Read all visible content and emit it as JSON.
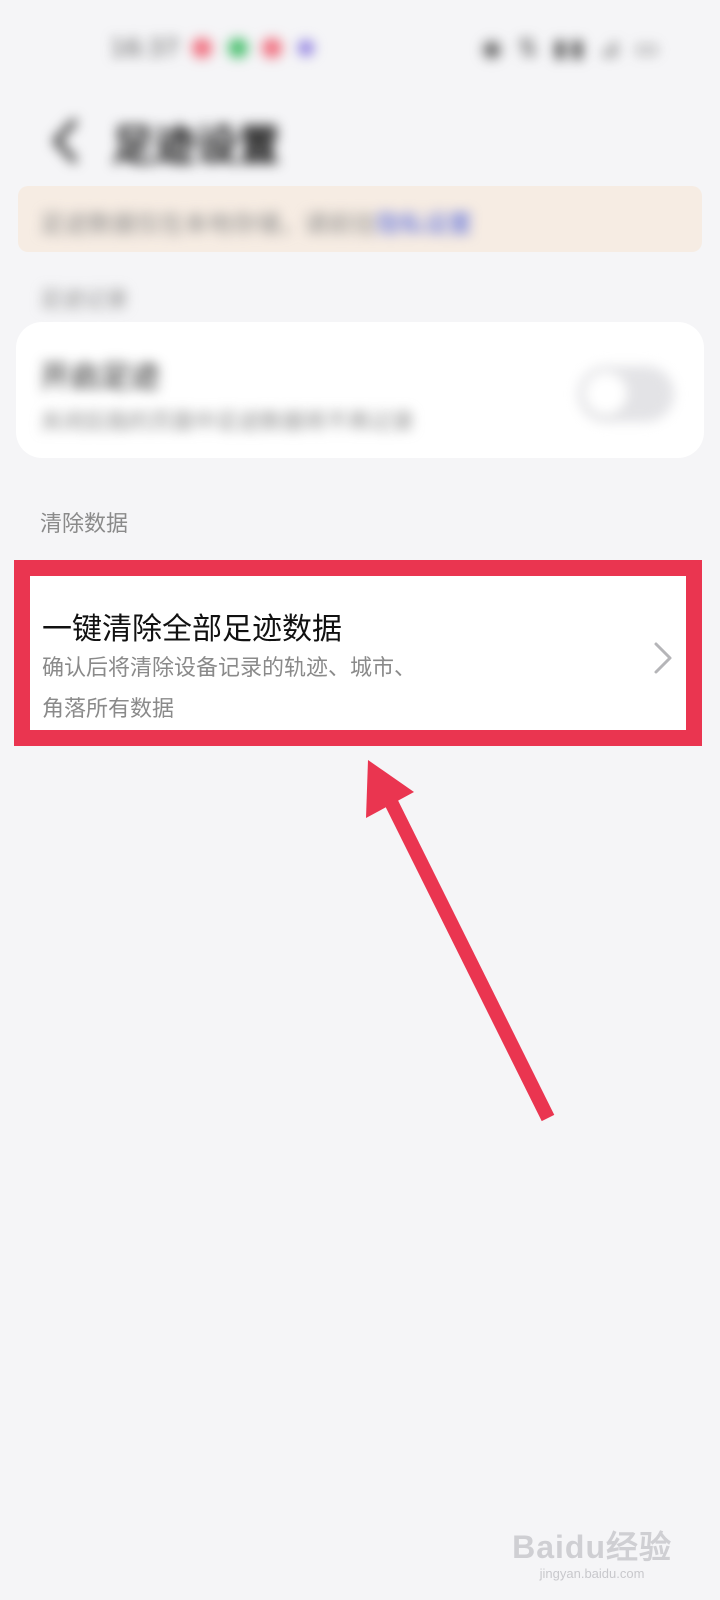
{
  "status_bar": {
    "time": "16:37",
    "right_icons": "◉ ⇅ ▮▮ ⊿ ▭"
  },
  "header": {
    "title": "足迹设置"
  },
  "notice": {
    "text": "足迹数据仅在本地存储，请前往",
    "link": "隐私设置"
  },
  "sections": {
    "record": {
      "label": "足迹记录",
      "item_title": "开启足迹",
      "item_subtitle": "关闭后我的页面中足迹数据将不再记录",
      "toggle_on": false
    },
    "clear": {
      "label": "清除数据",
      "item_title": "一键清除全部足迹数据",
      "item_desc_line1": "确认后将清除设备记录的轨迹、城市、",
      "item_desc_line2": "角落所有数据"
    }
  },
  "watermark": {
    "logo_text": "Baidu经验",
    "sub": "jingyan.baidu.com"
  },
  "colors": {
    "highlight": "#ea3550",
    "background": "#f5f5f7",
    "card": "#ffffff"
  }
}
